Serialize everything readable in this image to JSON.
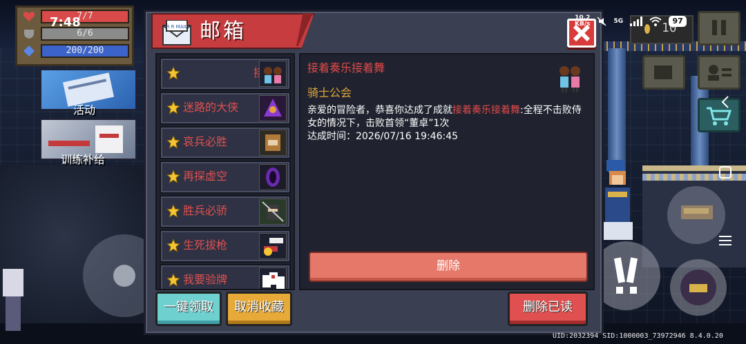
{
  "status_bar": {
    "time": "7:48",
    "net_speed_top": "10.2",
    "net_speed_bottom": "KB/s",
    "network": "5G",
    "battery": "97"
  },
  "player_stats": {
    "hp": "7/7",
    "armor": "6/6",
    "energy": "200/200",
    "hp_color": "#d94a4a",
    "armor_color": "#8b8b8b",
    "energy_color": "#3b63c9"
  },
  "sidebar": {
    "activity_label": "活动",
    "training_label": "训练补给"
  },
  "coins": {
    "value": "10"
  },
  "system": {
    "version_text": "UID:2032394 SID:1000003_73972946 8.4.0.20"
  },
  "dialog": {
    "title": "邮箱",
    "mail_icon_text": "R R MAIL",
    "list": [
      {
        "name": "接",
        "starred": true,
        "thumb_icon": "dancers-icon"
      },
      {
        "name": "迷路的大侠",
        "starred": true,
        "thumb_icon": "hooded-wizard-icon"
      },
      {
        "name": "哀兵必胜",
        "starred": true,
        "thumb_icon": "brown-bear-icon"
      },
      {
        "name": "再探虚空",
        "starred": true,
        "thumb_icon": "void-portal-icon"
      },
      {
        "name": "胜兵必骄",
        "starred": true,
        "thumb_icon": "ninja-icon"
      },
      {
        "name": "生死拔枪",
        "starred": true,
        "thumb_icon": "pistol-icon"
      },
      {
        "name": "我要验牌",
        "starred": true,
        "thumb_icon": "cards-icon"
      }
    ],
    "detail": {
      "title": "接着奏乐接着舞",
      "sender": "骑士公会",
      "body_prefix": "亲爱的冒险者，恭喜你达成了成就",
      "body_highlight": "接着奏乐接着舞",
      "body_suffix": ":全程不击败侍女的情况下，击败首领“董卓”1次",
      "achieved_time": "达成时间：2026/07/16 19:46:45",
      "delete_label": "删除"
    },
    "buttons": {
      "claim_all": "一键领取",
      "unfavorite": "取消收藏",
      "delete_read": "删除已读"
    },
    "colors": {
      "accent_red": "#e24a4a",
      "sender_gold": "#e0a73a",
      "banner": "#c73c3f"
    }
  }
}
